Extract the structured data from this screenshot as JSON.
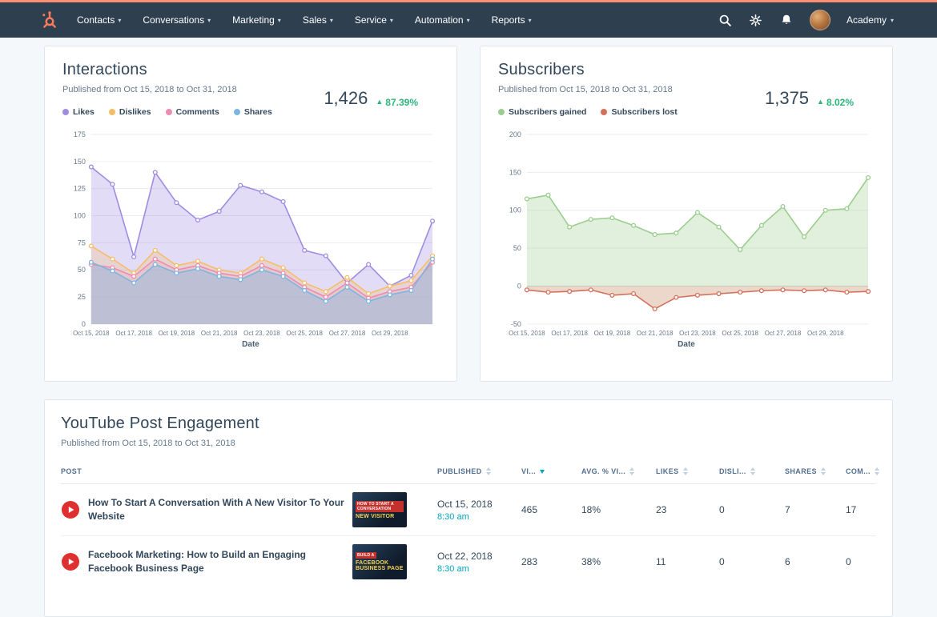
{
  "colors": {
    "brand_orange": "#ff7a59",
    "nav_background": "#2e3f50",
    "positive_green": "#2db67c",
    "link_teal": "#00a4bd",
    "page_background": "#f5f8fa",
    "text_primary": "#33475b"
  },
  "nav": {
    "items": [
      {
        "label": "Contacts"
      },
      {
        "label": "Conversations"
      },
      {
        "label": "Marketing"
      },
      {
        "label": "Sales"
      },
      {
        "label": "Service"
      },
      {
        "label": "Automation"
      },
      {
        "label": "Reports"
      }
    ],
    "academy_label": "Academy"
  },
  "interactions_card": {
    "title": "Interactions",
    "subtitle": "Published from Oct 15, 2018 to Oct 31, 2018",
    "total": "1,426",
    "delta": "87.39%"
  },
  "subscribers_card": {
    "title": "Subscribers",
    "subtitle": "Published from Oct 15, 2018 to Oct 31, 2018",
    "total": "1,375",
    "delta": "8.02%"
  },
  "engagement_card": {
    "title": "YouTube Post Engagement",
    "subtitle": "Published from Oct 15, 2018 to Oct 31, 2018",
    "columns": [
      {
        "label": "POST",
        "sortable": false,
        "sorted": null
      },
      {
        "label": "PUBLISHED",
        "sortable": true,
        "sorted": null
      },
      {
        "label": "VI...",
        "sortable": true,
        "sorted": "desc"
      },
      {
        "label": "AVG. % VI...",
        "sortable": true,
        "sorted": null
      },
      {
        "label": "LIKES",
        "sortable": true,
        "sorted": null
      },
      {
        "label": "DISLI...",
        "sortable": true,
        "sorted": null
      },
      {
        "label": "SHARES",
        "sortable": true,
        "sorted": null
      },
      {
        "label": "COM...",
        "sortable": true,
        "sorted": null
      }
    ],
    "rows": [
      {
        "title": "How To Start A Conversation With A New Visitor To Your Website",
        "thumb_tag": "HOW TO START A CONVERSATION",
        "thumb_caption": "NEW VISITOR",
        "date": "Oct 15, 2018",
        "time": "8:30 am",
        "views": "465",
        "avg_viewed": "18%",
        "likes": "23",
        "dislikes": "0",
        "shares": "7",
        "comments": "17"
      },
      {
        "title": "Facebook Marketing: How to Build an Engaging Facebook Business Page",
        "thumb_tag": "BUILD A",
        "thumb_caption": "FACEBOOK BUSINESS PAGE",
        "date": "Oct 22, 2018",
        "time": "8:30 am",
        "views": "283",
        "avg_viewed": "38%",
        "likes": "11",
        "dislikes": "0",
        "shares": "6",
        "comments": "0"
      }
    ]
  },
  "chart_data": [
    {
      "type": "line",
      "title": "Interactions",
      "xlabel": "Date",
      "ylim": [
        0,
        175
      ],
      "yticks": [
        0,
        25,
        50,
        75,
        100,
        125,
        150,
        175
      ],
      "x_tick_labels": [
        "Oct 15, 2018",
        "Oct 17, 2018",
        "Oct 19, 2018",
        "Oct 21, 2018",
        "Oct 23, 2018",
        "Oct 25, 2018",
        "Oct 27, 2018",
        "Oct 29, 2018"
      ],
      "legend_position": "top-left",
      "grid": true,
      "series": [
        {
          "name": "Likes",
          "color": "#9f8ce0",
          "fill": "rgba(159,140,224,0.30)",
          "values": [
            145,
            129,
            62,
            140,
            112,
            96,
            104,
            128,
            122,
            113,
            68,
            63,
            38,
            55,
            35,
            45,
            95
          ]
        },
        {
          "name": "Dislikes",
          "color": "#f7bd66",
          "fill": "rgba(247,189,102,0.25)",
          "values": [
            72,
            60,
            47,
            68,
            54,
            58,
            50,
            47,
            60,
            52,
            38,
            30,
            43,
            28,
            35,
            40,
            63
          ]
        },
        {
          "name": "Comments",
          "color": "#ee8bb1",
          "fill": "rgba(238,139,177,0.18)",
          "values": [
            55,
            52,
            44,
            60,
            50,
            54,
            47,
            44,
            54,
            47,
            34,
            25,
            38,
            24,
            30,
            34,
            57
          ]
        },
        {
          "name": "Shares",
          "color": "#7cb6e0",
          "fill": "rgba(124,182,224,0.40)",
          "values": [
            57,
            49,
            38,
            55,
            47,
            51,
            44,
            41,
            50,
            44,
            31,
            21,
            34,
            21,
            27,
            31,
            60
          ]
        }
      ]
    },
    {
      "type": "line",
      "title": "Subscribers",
      "xlabel": "Date",
      "ylim": [
        -50,
        200
      ],
      "yticks": [
        -50,
        0,
        50,
        100,
        150,
        200
      ],
      "x_tick_labels": [
        "Oct 15, 2018",
        "Oct 17, 2018",
        "Oct 19, 2018",
        "Oct 21, 2018",
        "Oct 23, 2018",
        "Oct 25, 2018",
        "Oct 27, 2018",
        "Oct 29, 2018"
      ],
      "legend_position": "top-left",
      "grid": true,
      "series": [
        {
          "name": "Subscribers gained",
          "color": "#9bcd8e",
          "fill": "rgba(155,205,142,0.30)",
          "values": [
            115,
            120,
            78,
            88,
            90,
            80,
            68,
            70,
            97,
            78,
            48,
            80,
            105,
            65,
            100,
            102,
            143
          ]
        },
        {
          "name": "Subscribers lost",
          "color": "#d4705a",
          "fill": "rgba(199,143,103,0.35)",
          "values": [
            -5,
            -8,
            -7,
            -5,
            -12,
            -10,
            -30,
            -15,
            -12,
            -10,
            -8,
            -6,
            -5,
            -6,
            -5,
            -8,
            -7
          ]
        }
      ]
    }
  ]
}
